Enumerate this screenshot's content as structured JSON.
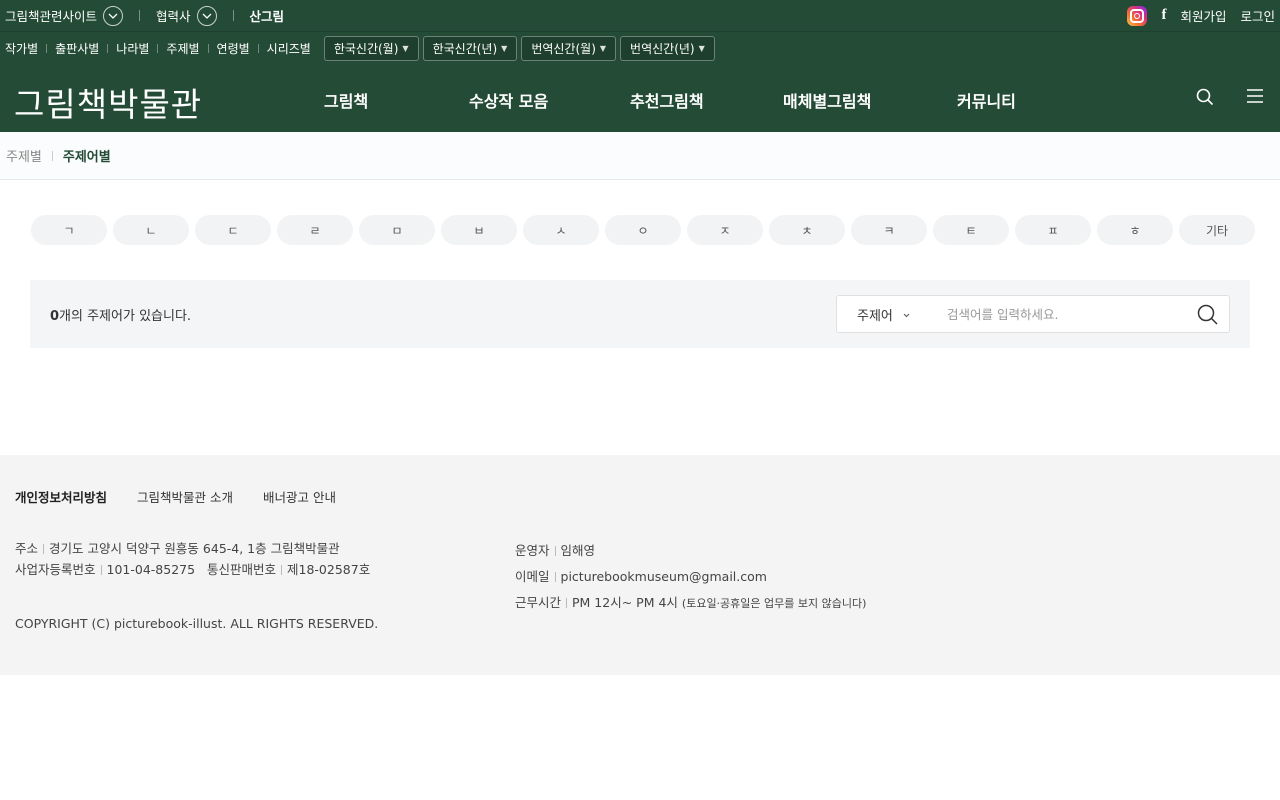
{
  "topbar": {
    "related_sites": "그림책관련사이트",
    "partners": "협력사",
    "sangrim": "산그림",
    "signup": "회원가입",
    "login": "로그인",
    "facebook_glyph": "f"
  },
  "subbar": {
    "links": [
      "작가별",
      "출판사별",
      "나라별",
      "주제별",
      "연령별",
      "시리즈별"
    ],
    "dropdowns": [
      "한국신간(월)",
      "한국신간(년)",
      "번역신간(월)",
      "번역신간(년)"
    ]
  },
  "header": {
    "logo": "그림책박물관",
    "nav": [
      "그림책",
      "수상작 모음",
      "추천그림책",
      "매체별그림책",
      "커뮤니티"
    ]
  },
  "breadcrumb": {
    "parent": "주제별",
    "current": "주제어별"
  },
  "consonants": [
    "ㄱ",
    "ㄴ",
    "ㄷ",
    "ㄹ",
    "ㅁ",
    "ㅂ",
    "ㅅ",
    "ㅇ",
    "ㅈ",
    "ㅊ",
    "ㅋ",
    "ㅌ",
    "ㅍ",
    "ㅎ",
    "기타"
  ],
  "result": {
    "count": "0",
    "count_suffix": "개의 주제어가 있습니다.",
    "search_type": "주제어",
    "search_placeholder": "검색어를 입력하세요."
  },
  "footer": {
    "links": [
      "개인정보처리방침",
      "그림책박물관 소개",
      "배너광고 안내"
    ],
    "address_label": "주소",
    "address": "경기도 고양시 덕양구 원흥동 645-4, 1층 그림책박물관",
    "biz_label": "사업자등록번호",
    "biz_no": "101-04-85275",
    "mail_order_label": "통신판매번호",
    "mail_order_no": "제18-02587호",
    "operator_label": "운영자",
    "operator": "임해영",
    "email_label": "이메일",
    "email": "picturebookmuseum@gmail.com",
    "hours_label": "근무시간",
    "hours": "PM 12시~ PM 4시",
    "hours_note": "(토요일·공휴일은 업무를 보지 않습니다)",
    "copyright": "COPYRIGHT (C) picturebook-illust. ALL RIGHTS RESERVED."
  },
  "colors": {
    "brand_green": "#244b36",
    "footer_bg": "#f4f4f4"
  }
}
